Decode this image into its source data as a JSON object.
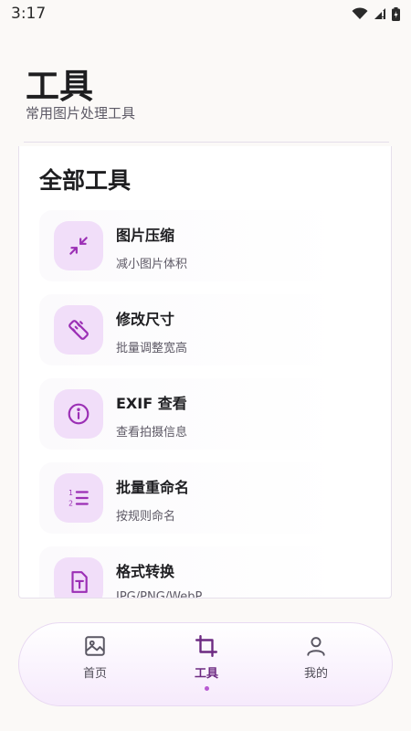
{
  "status_bar": {
    "time": "3:17"
  },
  "header": {
    "title": "工具",
    "subtitle": "常用图片处理工具"
  },
  "card": {
    "title": "全部工具",
    "tools": [
      {
        "name": "图片压缩",
        "desc": "减小图片体积",
        "icon": "compress-icon"
      },
      {
        "name": "修改尺寸",
        "desc": "批量调整宽高",
        "icon": "ruler-icon"
      },
      {
        "name": "EXIF 查看",
        "desc": "查看拍摄信息",
        "icon": "info-icon"
      },
      {
        "name": "批量重命名",
        "desc": "按规则命名",
        "icon": "numbered-list-icon"
      },
      {
        "name": "格式转换",
        "desc": "JPG/PNG/WebP",
        "icon": "text-file-icon"
      }
    ]
  },
  "bottom_nav": {
    "items": [
      {
        "label": "首页",
        "icon": "image-icon"
      },
      {
        "label": "工具",
        "icon": "crop-icon",
        "active": true
      },
      {
        "label": "我的",
        "icon": "person-icon"
      }
    ]
  },
  "colors": {
    "accent": "#9b2fb5",
    "icon_bg": "#f1def9",
    "active_label": "#6d2a82"
  }
}
